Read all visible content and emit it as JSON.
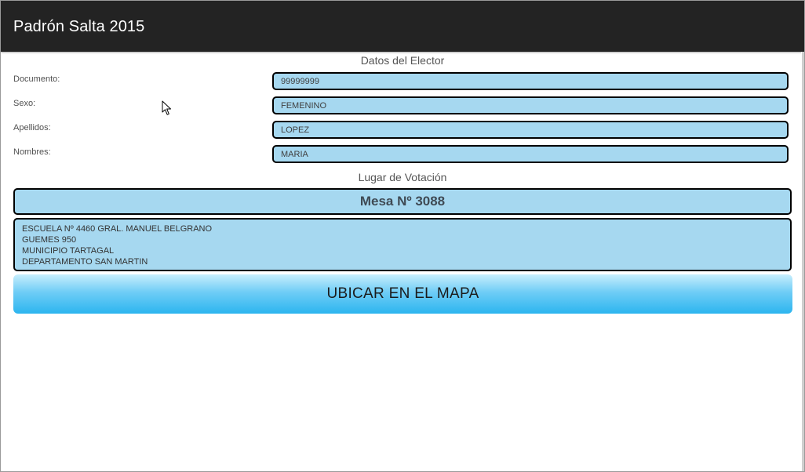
{
  "app": {
    "title": "Padrón Salta 2015"
  },
  "elector": {
    "section_title": "Datos del Elector",
    "fields": [
      {
        "label": "Documento:",
        "value": "99999999"
      },
      {
        "label": "Sexo:",
        "value": "FEMENINO"
      },
      {
        "label": "Apellidos:",
        "value": "LOPEZ"
      },
      {
        "label": "Nombres:",
        "value": "MARIA"
      }
    ]
  },
  "voting_place": {
    "section_title": "Lugar de Votación",
    "mesa": "Mesa Nº 3088",
    "address_lines": [
      "ESCUELA Nº 4460 GRAL. MANUEL BELGRANO",
      "GUEMES 950",
      "MUNICIPIO TARTAGAL",
      "DEPARTAMENTO SAN MARTIN"
    ]
  },
  "map_button": {
    "label": "UBICAR EN EL MAPA"
  },
  "icons": {
    "cursor": "mouse-pointer-icon"
  }
}
